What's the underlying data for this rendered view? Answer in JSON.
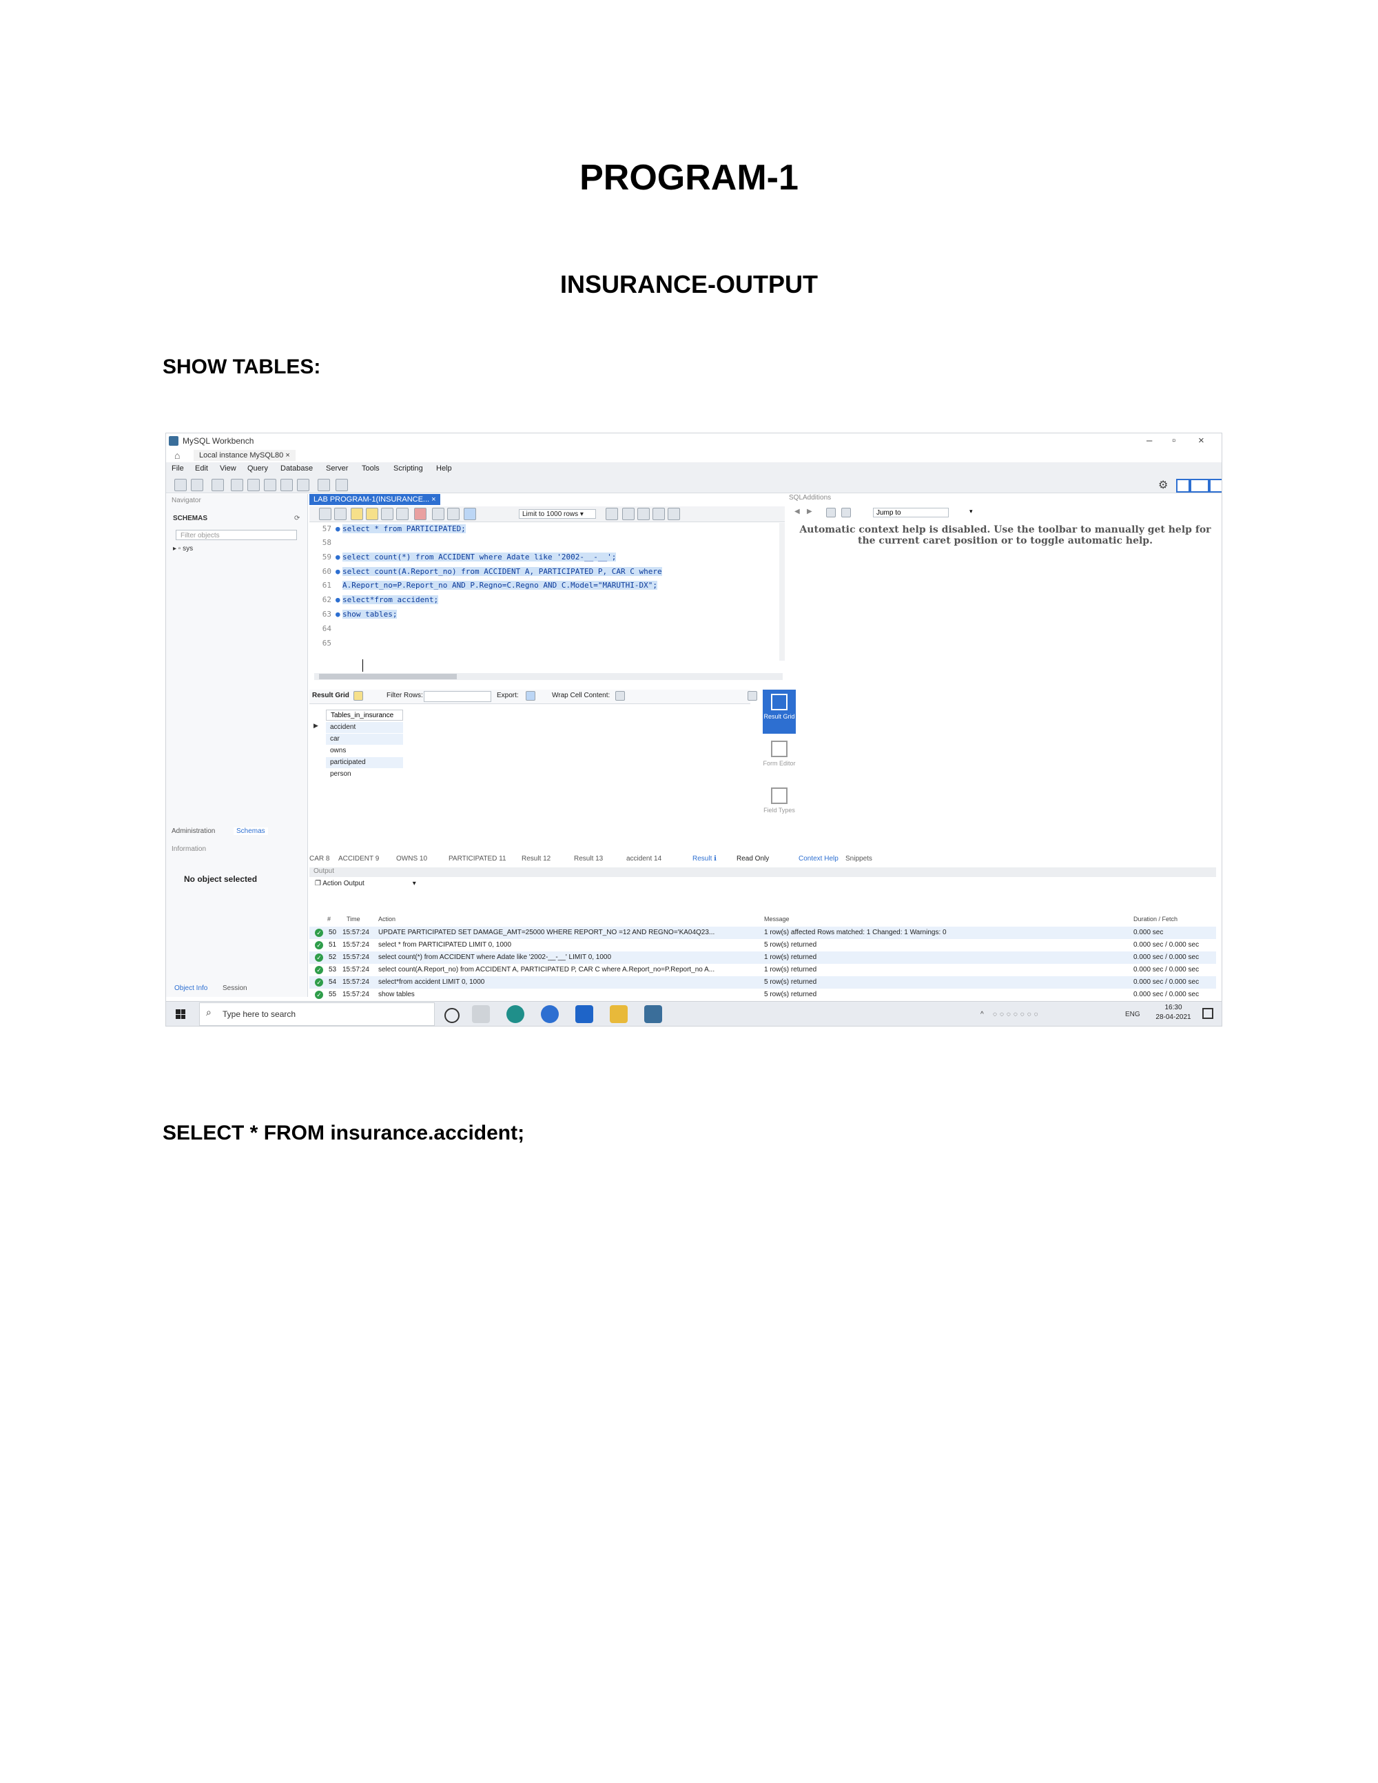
{
  "doc": {
    "title": "PROGRAM-1",
    "subtitle": "INSURANCE-OUTPUT",
    "heading_show": "SHOW TABLES:",
    "heading_select": "SELECT  * FROM insurance.accident;"
  },
  "window": {
    "title": "MySQL Workbench",
    "connection_tab": "Local instance MySQL80",
    "minimize": "–",
    "maximize": "▫",
    "close": "×"
  },
  "menu": [
    "File",
    "Edit",
    "View",
    "Query",
    "Database",
    "Server",
    "Tools",
    "Scripting",
    "Help"
  ],
  "navigator": {
    "header": "Navigator",
    "schemas_label": "SCHEMAS",
    "filter_placeholder": "Filter objects",
    "schema_item": "sys",
    "tab_administration": "Administration",
    "tab_schemas": "Schemas",
    "info_header": "Information",
    "no_object": "No object selected",
    "tab_object_info": "Object Info",
    "tab_session": "Session"
  },
  "editor": {
    "tab_label": "LAB PROGRAM-1(INSURANCE...",
    "limit_label": "Limit to 1000 rows",
    "lines": [
      {
        "num": "57",
        "dot": "●",
        "code": "select * from PARTICIPATED;"
      },
      {
        "num": "58",
        "dot": "",
        "code": ""
      },
      {
        "num": "59",
        "dot": "●",
        "code": "select count(*) from ACCIDENT where Adate like '2002-__-__';"
      },
      {
        "num": "60",
        "dot": "●",
        "code": "select count(A.Report_no) from ACCIDENT A, PARTICIPATED P, CAR C where"
      },
      {
        "num": "61",
        "dot": "",
        "code": "A.Report_no=P.Report_no AND P.Regno=C.Regno AND C.Model=\"MARUTHI-DX\";"
      },
      {
        "num": "62",
        "dot": "●",
        "code": "select*from accident;"
      },
      {
        "num": "63",
        "dot": "●",
        "code": "show tables;"
      },
      {
        "num": "64",
        "dot": "",
        "code": ""
      },
      {
        "num": "65",
        "dot": "",
        "code": ""
      }
    ]
  },
  "result_grid": {
    "label": "Result Grid",
    "filter_label": "Filter Rows:",
    "export_label": "Export:",
    "wrap_label": "Wrap Cell Content:",
    "column": "Tables_in_insurance",
    "rows": [
      "accident",
      "car",
      "owns",
      "participated",
      "person"
    ],
    "side_buttons": [
      "Result Grid",
      "Form Editor",
      "Field Types"
    ]
  },
  "result_tabs": [
    "CAR 8",
    "ACCIDENT 9",
    "OWNS 10",
    "PARTICIPATED 11",
    "Result 12",
    "Result 13",
    "accident 14",
    "Result"
  ],
  "read_only": "Read Only",
  "output": {
    "header": "Output",
    "selector": "Action Output",
    "columns": {
      "num": "#",
      "time": "Time",
      "action": "Action",
      "message": "Message",
      "duration": "Duration / Fetch"
    },
    "rows": [
      {
        "num": "50",
        "time": "15:57:24",
        "action": "UPDATE PARTICIPATED SET DAMAGE_AMT=25000 WHERE REPORT_NO =12 AND REGNO='KA04Q23...",
        "message": "1 row(s) affected Rows matched: 1  Changed: 1  Warnings: 0",
        "duration": "0.000 sec"
      },
      {
        "num": "51",
        "time": "15:57:24",
        "action": "select * from PARTICIPATED LIMIT 0, 1000",
        "message": "5 row(s) returned",
        "duration": "0.000 sec / 0.000 sec"
      },
      {
        "num": "52",
        "time": "15:57:24",
        "action": "select count(*) from ACCIDENT where Adate like '2002-__-__' LIMIT 0, 1000",
        "message": "1 row(s) returned",
        "duration": "0.000 sec / 0.000 sec"
      },
      {
        "num": "53",
        "time": "15:57:24",
        "action": "select count(A.Report_no) from ACCIDENT A, PARTICIPATED P, CAR C where  A.Report_no=P.Report_no A...",
        "message": "1 row(s) returned",
        "duration": "0.000 sec / 0.000 sec"
      },
      {
        "num": "54",
        "time": "15:57:24",
        "action": "select*from accident LIMIT 0, 1000",
        "message": "5 row(s) returned",
        "duration": "0.000 sec / 0.000 sec"
      },
      {
        "num": "55",
        "time": "15:57:24",
        "action": "show tables",
        "message": "5 row(s) returned",
        "duration": "0.000 sec / 0.000 sec"
      }
    ]
  },
  "sql_additions": {
    "header": "SQLAdditions",
    "jump_label": "Jump to",
    "help_text": "Automatic context help is disabled. Use the toolbar to manually get help for the current caret position or to toggle automatic help.",
    "tab_context_help": "Context Help",
    "tab_snippets": "Snippets"
  },
  "taskbar": {
    "search_placeholder": "Type here to search",
    "lang": "ENG",
    "time": "16:30",
    "date": "28-04-2021"
  },
  "colors": {
    "accent": "#2d6fd1",
    "selection": "#cfe2f7",
    "ok": "#2e9d4a"
  }
}
